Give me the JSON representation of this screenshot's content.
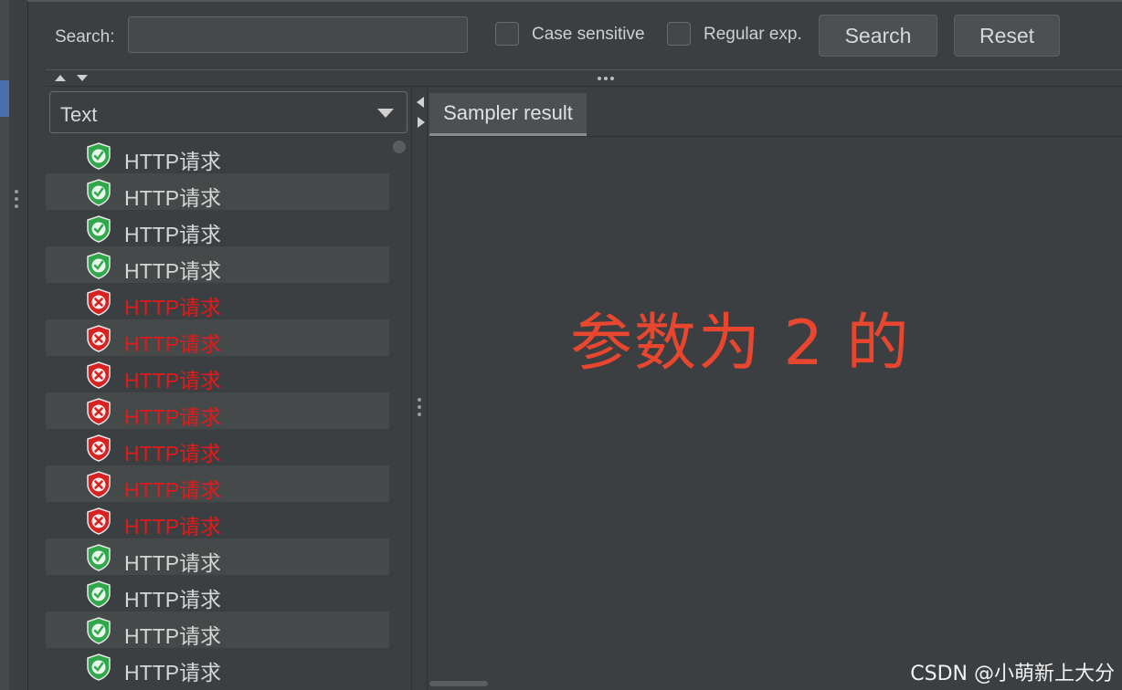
{
  "search": {
    "label": "Search:",
    "value": "",
    "placeholder": "",
    "case_sensitive_label": "Case sensitive",
    "regex_label": "Regular exp.",
    "search_button": "Search",
    "reset_button": "Reset"
  },
  "left_panel": {
    "renderer_selected": "Text",
    "tree": [
      {
        "label": "HTTP请求",
        "status": "success"
      },
      {
        "label": "HTTP请求",
        "status": "success"
      },
      {
        "label": "HTTP请求",
        "status": "success"
      },
      {
        "label": "HTTP请求",
        "status": "success"
      },
      {
        "label": "HTTP请求",
        "status": "error"
      },
      {
        "label": "HTTP请求",
        "status": "error"
      },
      {
        "label": "HTTP请求",
        "status": "error"
      },
      {
        "label": "HTTP请求",
        "status": "error"
      },
      {
        "label": "HTTP请求",
        "status": "error"
      },
      {
        "label": "HTTP请求",
        "status": "error"
      },
      {
        "label": "HTTP请求",
        "status": "error"
      },
      {
        "label": "HTTP请求",
        "status": "success"
      },
      {
        "label": "HTTP请求",
        "status": "success"
      },
      {
        "label": "HTTP请求",
        "status": "success"
      },
      {
        "label": "HTTP请求",
        "status": "success"
      }
    ]
  },
  "right_panel": {
    "tab_label": "Sampler result",
    "annotation": "参数为 2 的"
  },
  "watermark": "CSDN @小萌新上大分",
  "colors": {
    "background": "#3c3f41",
    "success_icon": "#2fa84a",
    "error_icon": "#d82121",
    "error_text": "#e11b1b",
    "annotation": "#e8462f"
  },
  "icons": {
    "success": "shield-check-icon",
    "error": "shield-x-icon"
  }
}
